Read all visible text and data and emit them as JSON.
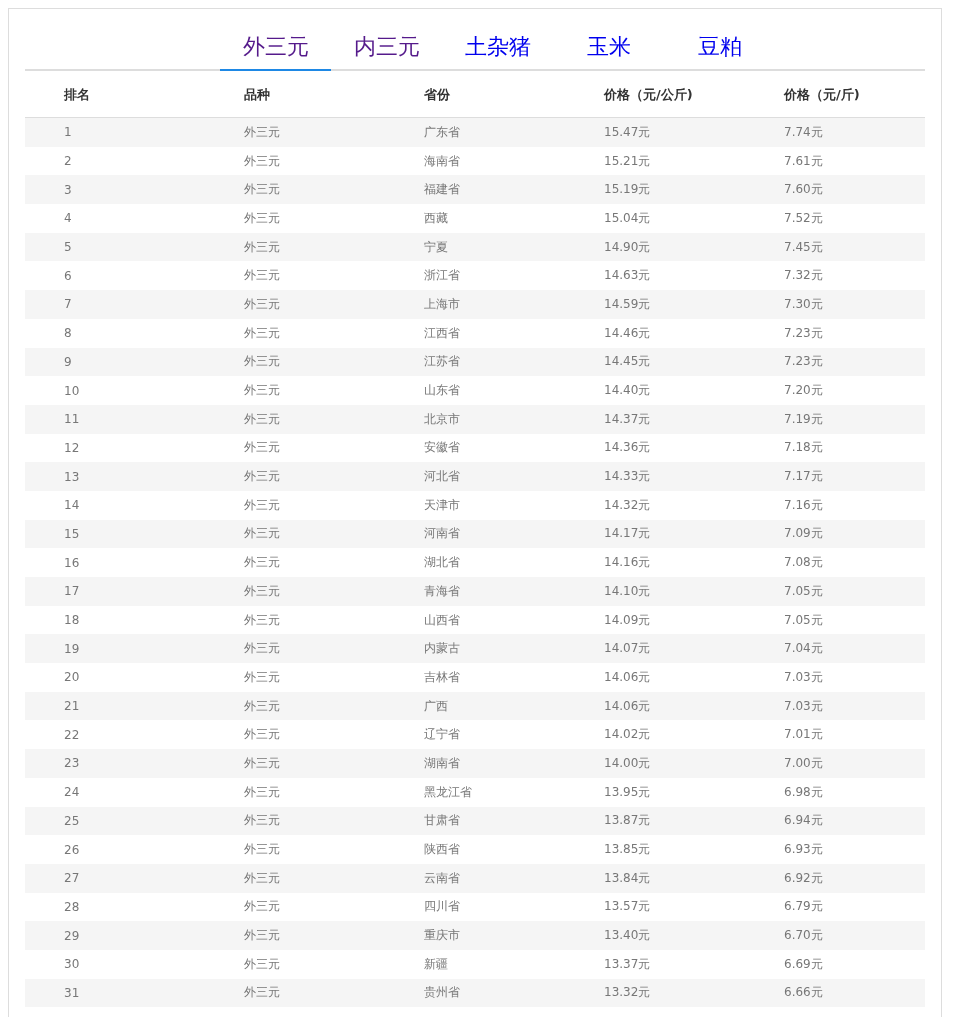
{
  "tabs": [
    {
      "label": "外三元",
      "selected": true,
      "visited": true
    },
    {
      "label": "内三元",
      "selected": false,
      "visited": true
    },
    {
      "label": "土杂猪",
      "selected": false,
      "visited": false
    },
    {
      "label": "玉米",
      "selected": false,
      "visited": false
    },
    {
      "label": "豆粕",
      "selected": false,
      "visited": false
    }
  ],
  "table": {
    "columns": [
      "排名",
      "品种",
      "省份",
      "价格（元/公斤)",
      "价格（元/斤)"
    ],
    "rows": [
      [
        "1",
        "外三元",
        "广东省",
        "15.47元",
        "7.74元"
      ],
      [
        "2",
        "外三元",
        "海南省",
        "15.21元",
        "7.61元"
      ],
      [
        "3",
        "外三元",
        "福建省",
        "15.19元",
        "7.60元"
      ],
      [
        "4",
        "外三元",
        "西藏",
        "15.04元",
        "7.52元"
      ],
      [
        "5",
        "外三元",
        "宁夏",
        "14.90元",
        "7.45元"
      ],
      [
        "6",
        "外三元",
        "浙江省",
        "14.63元",
        "7.32元"
      ],
      [
        "7",
        "外三元",
        "上海市",
        "14.59元",
        "7.30元"
      ],
      [
        "8",
        "外三元",
        "江西省",
        "14.46元",
        "7.23元"
      ],
      [
        "9",
        "外三元",
        "江苏省",
        "14.45元",
        "7.23元"
      ],
      [
        "10",
        "外三元",
        "山东省",
        "14.40元",
        "7.20元"
      ],
      [
        "11",
        "外三元",
        "北京市",
        "14.37元",
        "7.19元"
      ],
      [
        "12",
        "外三元",
        "安徽省",
        "14.36元",
        "7.18元"
      ],
      [
        "13",
        "外三元",
        "河北省",
        "14.33元",
        "7.17元"
      ],
      [
        "14",
        "外三元",
        "天津市",
        "14.32元",
        "7.16元"
      ],
      [
        "15",
        "外三元",
        "河南省",
        "14.17元",
        "7.09元"
      ],
      [
        "16",
        "外三元",
        "湖北省",
        "14.16元",
        "7.08元"
      ],
      [
        "17",
        "外三元",
        "青海省",
        "14.10元",
        "7.05元"
      ],
      [
        "18",
        "外三元",
        "山西省",
        "14.09元",
        "7.05元"
      ],
      [
        "19",
        "外三元",
        "内蒙古",
        "14.07元",
        "7.04元"
      ],
      [
        "20",
        "外三元",
        "吉林省",
        "14.06元",
        "7.03元"
      ],
      [
        "21",
        "外三元",
        "广西",
        "14.06元",
        "7.03元"
      ],
      [
        "22",
        "外三元",
        "辽宁省",
        "14.02元",
        "7.01元"
      ],
      [
        "23",
        "外三元",
        "湖南省",
        "14.00元",
        "7.00元"
      ],
      [
        "24",
        "外三元",
        "黑龙江省",
        "13.95元",
        "6.98元"
      ],
      [
        "25",
        "外三元",
        "甘肃省",
        "13.87元",
        "6.94元"
      ],
      [
        "26",
        "外三元",
        "陕西省",
        "13.85元",
        "6.93元"
      ],
      [
        "27",
        "外三元",
        "云南省",
        "13.84元",
        "6.92元"
      ],
      [
        "28",
        "外三元",
        "四川省",
        "13.57元",
        "6.79元"
      ],
      [
        "29",
        "外三元",
        "重庆市",
        "13.40元",
        "6.70元"
      ],
      [
        "30",
        "外三元",
        "新疆",
        "13.37元",
        "6.69元"
      ],
      [
        "31",
        "外三元",
        "贵州省",
        "13.32元",
        "6.66元"
      ]
    ]
  }
}
